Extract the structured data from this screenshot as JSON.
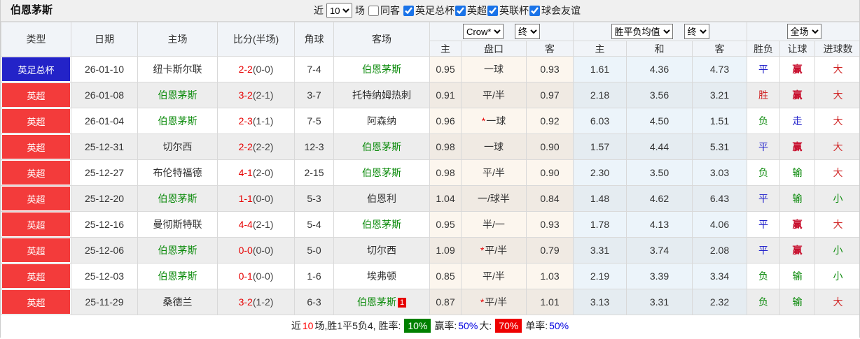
{
  "header": {
    "title": "伯恩茅斯",
    "near_label": "近",
    "games_select": "10",
    "games_label": "场",
    "same_away_label": "同客",
    "same_away_checked": false,
    "league_filters": [
      {
        "label": "英足总杯",
        "checked": true
      },
      {
        "label": "英超",
        "checked": true
      },
      {
        "label": "英联杯",
        "checked": true
      },
      {
        "label": "球会友谊",
        "checked": true
      }
    ]
  },
  "table": {
    "group_selects": {
      "odds_source": "Crow*",
      "odds_time": "终",
      "avg_label": "胜平负均值",
      "avg_time": "终",
      "scope": "全场"
    },
    "columns": [
      "类型",
      "日期",
      "主场",
      "比分(半场)",
      "角球",
      "客场",
      "主",
      "盘口",
      "客",
      "主",
      "和",
      "客",
      "胜负",
      "让球",
      "进球数"
    ],
    "rows": [
      {
        "league": "英足总杯",
        "league_type": "cup",
        "date": "26-01-10",
        "home": "纽卡斯尔联",
        "home_is_self": false,
        "score": "2-2",
        "half": "(0-0)",
        "corners": "7-4",
        "away": "伯恩茅斯",
        "away_is_self": true,
        "away_sup": "",
        "odds_home": "0.95",
        "handicap": "一球",
        "handicap_star": false,
        "odds_away": "0.93",
        "avg_home": "1.61",
        "avg_draw": "4.36",
        "avg_away": "4.73",
        "result": "平",
        "result_color": "blue",
        "handicap_result": "赢",
        "handicap_result_color": "red-bold",
        "goals": "大",
        "goals_color": "red"
      },
      {
        "league": "英超",
        "league_type": "epl",
        "date": "26-01-08",
        "home": "伯恩茅斯",
        "home_is_self": true,
        "score": "3-2",
        "half": "(2-1)",
        "corners": "3-7",
        "away": "托特纳姆热刺",
        "away_is_self": false,
        "away_sup": "",
        "odds_home": "0.91",
        "handicap": "平/半",
        "handicap_star": false,
        "odds_away": "0.97",
        "avg_home": "2.18",
        "avg_draw": "3.56",
        "avg_away": "3.21",
        "result": "胜",
        "result_color": "red",
        "handicap_result": "赢",
        "handicap_result_color": "red-bold",
        "goals": "大",
        "goals_color": "red"
      },
      {
        "league": "英超",
        "league_type": "epl",
        "date": "26-01-04",
        "home": "伯恩茅斯",
        "home_is_self": true,
        "score": "2-3",
        "half": "(1-1)",
        "corners": "7-5",
        "away": "阿森纳",
        "away_is_self": false,
        "away_sup": "",
        "odds_home": "0.96",
        "handicap": "一球",
        "handicap_star": true,
        "odds_away": "0.92",
        "avg_home": "6.03",
        "avg_draw": "4.50",
        "avg_away": "1.51",
        "result": "负",
        "result_color": "green",
        "handicap_result": "走",
        "handicap_result_color": "blue",
        "goals": "大",
        "goals_color": "red"
      },
      {
        "league": "英超",
        "league_type": "epl",
        "date": "25-12-31",
        "home": "切尔西",
        "home_is_self": false,
        "score": "2-2",
        "half": "(2-2)",
        "corners": "12-3",
        "away": "伯恩茅斯",
        "away_is_self": true,
        "away_sup": "",
        "odds_home": "0.98",
        "handicap": "一球",
        "handicap_star": false,
        "odds_away": "0.90",
        "avg_home": "1.57",
        "avg_draw": "4.44",
        "avg_away": "5.31",
        "result": "平",
        "result_color": "blue",
        "handicap_result": "赢",
        "handicap_result_color": "red-bold",
        "goals": "大",
        "goals_color": "red"
      },
      {
        "league": "英超",
        "league_type": "epl",
        "date": "25-12-27",
        "home": "布伦特福德",
        "home_is_self": false,
        "score": "4-1",
        "half": "(2-0)",
        "corners": "2-15",
        "away": "伯恩茅斯",
        "away_is_self": true,
        "away_sup": "",
        "odds_home": "0.98",
        "handicap": "平/半",
        "handicap_star": false,
        "odds_away": "0.90",
        "avg_home": "2.30",
        "avg_draw": "3.50",
        "avg_away": "3.03",
        "result": "负",
        "result_color": "green",
        "handicap_result": "输",
        "handicap_result_color": "green",
        "goals": "大",
        "goals_color": "red"
      },
      {
        "league": "英超",
        "league_type": "epl",
        "date": "25-12-20",
        "home": "伯恩茅斯",
        "home_is_self": true,
        "score": "1-1",
        "half": "(0-0)",
        "corners": "5-3",
        "away": "伯恩利",
        "away_is_self": false,
        "away_sup": "",
        "odds_home": "1.04",
        "handicap": "一/球半",
        "handicap_star": false,
        "odds_away": "0.84",
        "avg_home": "1.48",
        "avg_draw": "4.62",
        "avg_away": "6.43",
        "result": "平",
        "result_color": "blue",
        "handicap_result": "输",
        "handicap_result_color": "green",
        "goals": "小",
        "goals_color": "green"
      },
      {
        "league": "英超",
        "league_type": "epl",
        "date": "25-12-16",
        "home": "曼彻斯特联",
        "home_is_self": false,
        "score": "4-4",
        "half": "(2-1)",
        "corners": "5-4",
        "away": "伯恩茅斯",
        "away_is_self": true,
        "away_sup": "",
        "odds_home": "0.95",
        "handicap": "半/一",
        "handicap_star": false,
        "odds_away": "0.93",
        "avg_home": "1.78",
        "avg_draw": "4.13",
        "avg_away": "4.06",
        "result": "平",
        "result_color": "blue",
        "handicap_result": "赢",
        "handicap_result_color": "red-bold",
        "goals": "大",
        "goals_color": "red"
      },
      {
        "league": "英超",
        "league_type": "epl",
        "date": "25-12-06",
        "home": "伯恩茅斯",
        "home_is_self": true,
        "score": "0-0",
        "half": "(0-0)",
        "corners": "5-0",
        "away": "切尔西",
        "away_is_self": false,
        "away_sup": "",
        "odds_home": "1.09",
        "handicap": "平/半",
        "handicap_star": true,
        "odds_away": "0.79",
        "avg_home": "3.31",
        "avg_draw": "3.74",
        "avg_away": "2.08",
        "result": "平",
        "result_color": "blue",
        "handicap_result": "赢",
        "handicap_result_color": "red-bold",
        "goals": "小",
        "goals_color": "green"
      },
      {
        "league": "英超",
        "league_type": "epl",
        "date": "25-12-03",
        "home": "伯恩茅斯",
        "home_is_self": true,
        "score": "0-1",
        "half": "(0-0)",
        "corners": "1-6",
        "away": "埃弗顿",
        "away_is_self": false,
        "away_sup": "",
        "odds_home": "0.85",
        "handicap": "平/半",
        "handicap_star": false,
        "odds_away": "1.03",
        "avg_home": "2.19",
        "avg_draw": "3.39",
        "avg_away": "3.34",
        "result": "负",
        "result_color": "green",
        "handicap_result": "输",
        "handicap_result_color": "green",
        "goals": "小",
        "goals_color": "green"
      },
      {
        "league": "英超",
        "league_type": "epl",
        "date": "25-11-29",
        "home": "桑德兰",
        "home_is_self": false,
        "score": "3-2",
        "half": "(1-2)",
        "corners": "6-3",
        "away": "伯恩茅斯",
        "away_is_self": true,
        "away_sup": "1",
        "odds_home": "0.87",
        "handicap": "平/半",
        "handicap_star": true,
        "odds_away": "1.01",
        "avg_home": "3.13",
        "avg_draw": "3.31",
        "avg_away": "2.32",
        "result": "负",
        "result_color": "green",
        "handicap_result": "输",
        "handicap_result_color": "green",
        "goals": "大",
        "goals_color": "red"
      }
    ]
  },
  "footer": {
    "near": "近",
    "count": "10",
    "summary": "场,胜1平5负4, 胜率:",
    "win_rate_badge": "10%",
    "win_label": "赢率:",
    "win_pct": "50%",
    "big_label": "大:",
    "big_rate_badge": "70%",
    "single_label": "单率:",
    "single_pct": "50%"
  },
  "colors": {
    "league_cup_bg": "#2323c8",
    "league_epl_bg": "#f33b3b",
    "team_self_green": "#0a8a0a",
    "score_red": "#e60000",
    "result_blue": "#2323cb",
    "result_green": "#0b8a0b",
    "result_red": "#d02525",
    "footer_badge_green": "#008000",
    "footer_badge_red": "#ee0000"
  }
}
